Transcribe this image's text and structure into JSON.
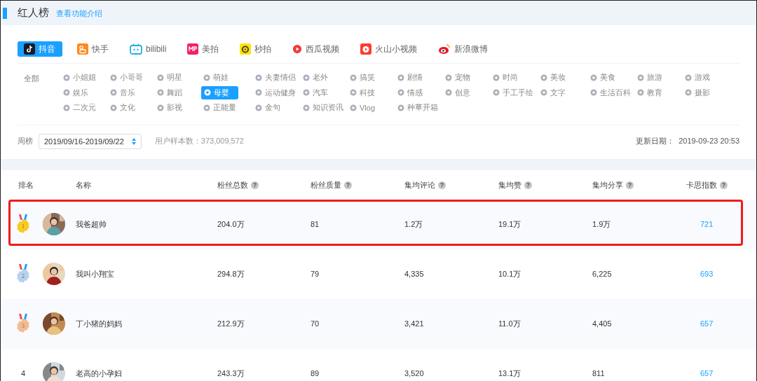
{
  "header": {
    "title": "红人榜",
    "link": "查看功能介绍"
  },
  "platforms": [
    {
      "label": "抖音",
      "selected": true
    },
    {
      "label": "快手",
      "selected": false
    },
    {
      "label": "bilibili",
      "selected": false
    },
    {
      "label": "美拍",
      "selected": false
    },
    {
      "label": "秒拍",
      "selected": false
    },
    {
      "label": "西瓜视频",
      "selected": false
    },
    {
      "label": "火山小视频",
      "selected": false
    },
    {
      "label": "新浪微博",
      "selected": false
    }
  ],
  "categories": {
    "all": {
      "label": "全部"
    },
    "items": [
      {
        "label": "小姐姐",
        "selected": false
      },
      {
        "label": "小哥哥",
        "selected": false
      },
      {
        "label": "明星",
        "selected": false
      },
      {
        "label": "萌娃",
        "selected": false
      },
      {
        "label": "夫妻情侣",
        "selected": false
      },
      {
        "label": "老外",
        "selected": false
      },
      {
        "label": "搞笑",
        "selected": false
      },
      {
        "label": "剧情",
        "selected": false
      },
      {
        "label": "宠物",
        "selected": false
      },
      {
        "label": "时尚",
        "selected": false
      },
      {
        "label": "美妆",
        "selected": false
      },
      {
        "label": "美食",
        "selected": false
      },
      {
        "label": "旅游",
        "selected": false
      },
      {
        "label": "游戏",
        "selected": false
      },
      {
        "label": "娱乐",
        "selected": false
      },
      {
        "label": "音乐",
        "selected": false
      },
      {
        "label": "舞蹈",
        "selected": false
      },
      {
        "label": "母婴",
        "selected": true
      },
      {
        "label": "运动健身",
        "selected": false
      },
      {
        "label": "汽车",
        "selected": false
      },
      {
        "label": "科技",
        "selected": false
      },
      {
        "label": "情感",
        "selected": false
      },
      {
        "label": "创意",
        "selected": false
      },
      {
        "label": "手工手绘",
        "selected": false
      },
      {
        "label": "文字",
        "selected": false
      },
      {
        "label": "生活百科",
        "selected": false
      },
      {
        "label": "教育",
        "selected": false
      },
      {
        "label": "摄影",
        "selected": false
      },
      {
        "label": "二次元",
        "selected": false
      },
      {
        "label": "文化",
        "selected": false
      },
      {
        "label": "影视",
        "selected": false
      },
      {
        "label": "正能量",
        "selected": false
      },
      {
        "label": "金句",
        "selected": false
      },
      {
        "label": "知识资讯",
        "selected": false
      },
      {
        "label": "Vlog",
        "selected": false
      },
      {
        "label": "种草开箱",
        "selected": false
      }
    ]
  },
  "toolbar": {
    "period_label": "周榜",
    "period": "2019/09/16-2019/09/22",
    "sample": "用户样本数：373,009,572",
    "updated": "更新日期：  2019-09-23 20:53"
  },
  "table": {
    "columns": [
      {
        "label": "排名"
      },
      {
        "label": "名称"
      },
      {
        "label": "粉丝总数",
        "hint": "?"
      },
      {
        "label": "粉丝质量",
        "hint": "?"
      },
      {
        "label": "集均评论",
        "hint": "?"
      },
      {
        "label": "集均赞",
        "hint": "?"
      },
      {
        "label": "集均分享",
        "hint": "?"
      },
      {
        "label": "卡思指数",
        "hint": "?"
      }
    ],
    "rows": [
      {
        "kind": "medal",
        "color": "#f7cc1d",
        "highlighted": true,
        "cells": [
          "1",
          "我爸超帅",
          "204.0万",
          "81",
          "1.2万",
          "19.1万",
          "1.9万",
          "721"
        ]
      },
      {
        "kind": "medal",
        "color": "#b5d1f0",
        "highlighted": false,
        "cells": [
          "2",
          "我叫小翔宝",
          "294.8万",
          "79",
          "4,335",
          "10.1万",
          "6,225",
          "693"
        ]
      },
      {
        "kind": "medal",
        "color": "#f3bb8f",
        "highlighted": false,
        "cells": [
          "3",
          "丁小猪的妈妈",
          "212.9万",
          "70",
          "3,421",
          "11.0万",
          "4,405",
          "657"
        ]
      },
      {
        "kind": "plain",
        "highlighted": false,
        "cells": [
          "4",
          "老高的小孕妇",
          "243.3万",
          "89",
          "3,520",
          "13.1万",
          "811",
          "657"
        ]
      }
    ]
  }
}
